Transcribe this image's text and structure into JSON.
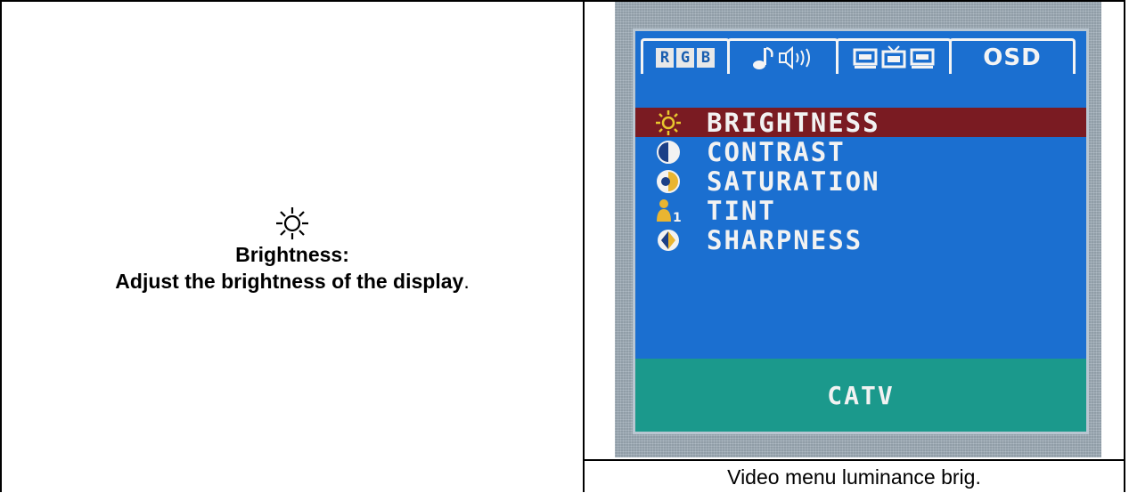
{
  "left": {
    "title": "Brightness:",
    "description_bold": "Adjust the brightness of the display",
    "description_end": ".",
    "icon": "sun-icon"
  },
  "osd": {
    "tabs": [
      {
        "label": "RGB",
        "letters": [
          "R",
          "G",
          "B"
        ],
        "icon": "rgb-icon"
      },
      {
        "label": "",
        "icon": "audio-icon"
      },
      {
        "label": "",
        "icon": "input-source-icon"
      },
      {
        "label": "OSD"
      }
    ],
    "menu": [
      {
        "label": "BRIGHTNESS",
        "icon": "sun-icon",
        "selected": true
      },
      {
        "label": "CONTRAST",
        "icon": "contrast-icon",
        "selected": false
      },
      {
        "label": "SATURATION",
        "icon": "saturation-icon",
        "selected": false
      },
      {
        "label": "TINT",
        "icon": "tint-icon",
        "selected": false
      },
      {
        "label": "SHARPNESS",
        "icon": "sharpness-icon",
        "selected": false
      }
    ],
    "footer": "CATV",
    "colors": {
      "background": "#1b6fd0",
      "selected": "#7a1b22",
      "footer": "#1b998c"
    }
  },
  "caption": "Video menu luminance brig."
}
